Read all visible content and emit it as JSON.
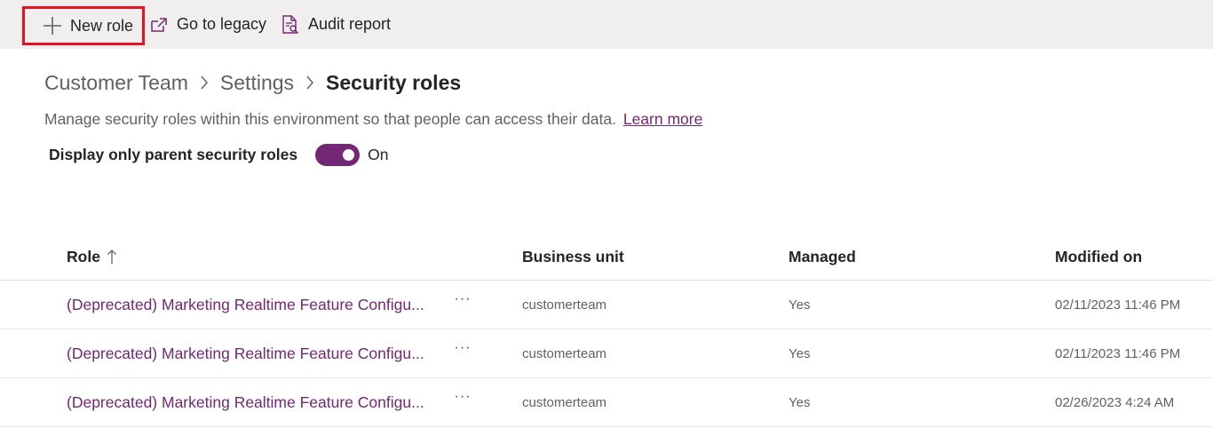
{
  "command_bar": {
    "new_role": {
      "label": "New role",
      "icon": "plus-icon"
    },
    "go_to_legacy": {
      "label": "Go to legacy",
      "icon": "open-external-icon"
    },
    "audit_report": {
      "label": "Audit report",
      "icon": "report-search-icon"
    }
  },
  "breadcrumb": {
    "items": [
      "Customer Team",
      "Settings"
    ],
    "current": "Security roles",
    "separator_icon": "chevron-right-icon"
  },
  "description": {
    "text": "Manage security roles within this environment so that people can access their data.",
    "link": "Learn more"
  },
  "toggle": {
    "label": "Display only parent security roles",
    "state_label": "On",
    "on": true
  },
  "table": {
    "columns": {
      "role": "Role",
      "sort_icon": "arrow-up-icon",
      "business_unit": "Business unit",
      "managed": "Managed",
      "modified_on": "Modified on"
    },
    "more_label": "···",
    "rows": [
      {
        "role": "(Deprecated) Marketing Realtime Feature Configu...",
        "business_unit": "customerteam",
        "managed": "Yes",
        "modified_on": "02/11/2023 11:46 PM"
      },
      {
        "role": "(Deprecated) Marketing Realtime Feature Configu...",
        "business_unit": "customerteam",
        "managed": "Yes",
        "modified_on": "02/11/2023 11:46 PM"
      },
      {
        "role": "(Deprecated) Marketing Realtime Feature Configu...",
        "business_unit": "customerteam",
        "managed": "Yes",
        "modified_on": "02/26/2023 4:24 AM"
      }
    ]
  },
  "colors": {
    "accent": "#742774",
    "highlight_border": "#e81123",
    "command_bar_bg": "#f0efee"
  }
}
